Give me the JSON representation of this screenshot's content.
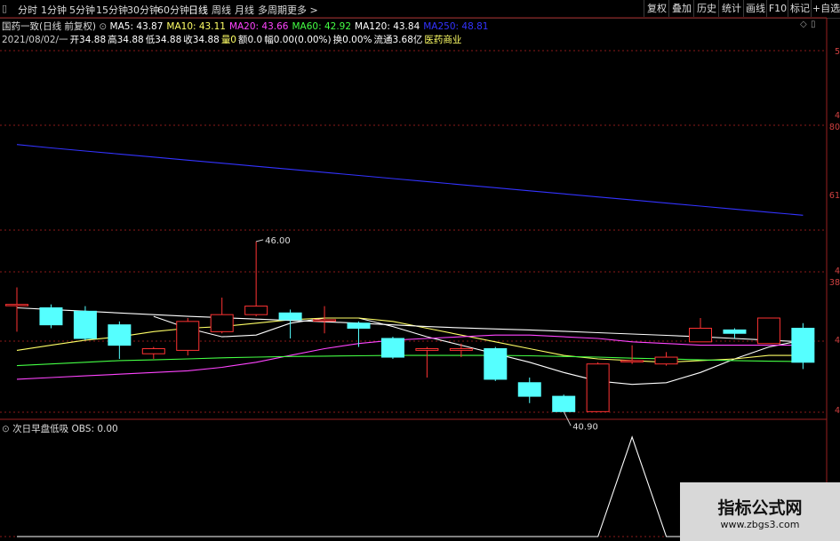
{
  "toolbar": {
    "periods": [
      "分时",
      "1分钟",
      "5分钟",
      "15分钟",
      "30分钟",
      "60分钟",
      "日线",
      "周线",
      "月线",
      "多周期",
      "更多 >"
    ],
    "active_period": "日线",
    "right_buttons": [
      "复权",
      "叠加",
      "历史",
      "统计",
      "画线",
      "F10",
      "标记",
      "+自选"
    ]
  },
  "header": {
    "stock_name": "国药一致(日线 前复权)",
    "ma": [
      {
        "label": "MA5: 43.87",
        "color": "#ffffff"
      },
      {
        "label": "MA10: 43.11",
        "color": "#ffff66"
      },
      {
        "label": "MA20: 43.66",
        "color": "#ff44ff"
      },
      {
        "label": "MA60: 42.92",
        "color": "#44ff44"
      },
      {
        "label": "MA120: 43.84",
        "color": "#ffffff"
      },
      {
        "label": "MA250: 48.81",
        "color": "#3333ff"
      }
    ],
    "bar_info": [
      {
        "label": "2021/08/02/一",
        "color": "#cccccc"
      },
      {
        "label": "开34.88",
        "color": "#ffffff"
      },
      {
        "label": "高34.88",
        "color": "#ffffff"
      },
      {
        "label": "低34.88",
        "color": "#ffffff"
      },
      {
        "label": "收34.88",
        "color": "#ffffff"
      },
      {
        "label": "量0",
        "color": "#ffff66"
      },
      {
        "label": "额0.0",
        "color": "#ffffff"
      },
      {
        "label": "幅0.00(0.00%)",
        "color": "#ffffff"
      },
      {
        "label": "换0.00%",
        "color": "#ffffff"
      },
      {
        "label": "流通3.68亿",
        "color": "#ffffff"
      },
      {
        "label": "医药商业",
        "color": "#ffff66"
      }
    ]
  },
  "annotations": {
    "high": "46.00",
    "low": "40.90"
  },
  "indicator": {
    "title": "次日早盘低吸",
    "obs": "OBS: 0.00"
  },
  "right_axis": [
    "5",
    "4",
    "80",
    "61",
    "4",
    "38",
    "4",
    "4"
  ],
  "watermark": {
    "title": "指标公式网",
    "url": "www.zbgs3.com"
  },
  "colors": {
    "up": "#ff3333",
    "down": "#55ffff",
    "grid": "#8b1a1a"
  },
  "candles": [
    {
      "o": 44.05,
      "c": 44.05,
      "h": 44.55,
      "l": 43.25
    },
    {
      "o": 43.95,
      "c": 43.45,
      "h": 44.05,
      "l": 43.35
    },
    {
      "o": 43.85,
      "c": 43.05,
      "h": 44.0,
      "l": 43.0
    },
    {
      "o": 43.45,
      "c": 42.85,
      "h": 43.55,
      "l": 42.45
    },
    {
      "o": 42.6,
      "c": 42.75,
      "h": 42.8,
      "l": 42.45
    },
    {
      "o": 42.7,
      "c": 43.55,
      "h": 43.65,
      "l": 42.55
    },
    {
      "o": 43.25,
      "c": 43.75,
      "h": 44.25,
      "l": 43.2
    },
    {
      "o": 43.75,
      "c": 44.0,
      "h": 45.9,
      "l": 43.7
    },
    {
      "o": 43.8,
      "c": 43.6,
      "h": 43.9,
      "l": 43.05
    },
    {
      "o": 43.6,
      "c": 43.6,
      "h": 44.0,
      "l": 43.2
    },
    {
      "o": 43.5,
      "c": 43.35,
      "h": 43.55,
      "l": 42.8
    },
    {
      "o": 43.05,
      "c": 42.5,
      "h": 43.1,
      "l": 42.45
    },
    {
      "o": 42.7,
      "c": 42.75,
      "h": 42.8,
      "l": 41.9
    },
    {
      "o": 42.7,
      "c": 42.75,
      "h": 42.9,
      "l": 42.5
    },
    {
      "o": 42.75,
      "c": 41.85,
      "h": 42.8,
      "l": 41.8
    },
    {
      "o": 41.75,
      "c": 41.35,
      "h": 41.9,
      "l": 41.15
    },
    {
      "o": 41.35,
      "c": 40.9,
      "h": 41.4,
      "l": 40.9
    },
    {
      "o": 40.9,
      "c": 42.3,
      "h": 42.35,
      "l": 40.9
    },
    {
      "o": 42.4,
      "c": 42.4,
      "h": 42.85,
      "l": 42.3
    },
    {
      "o": 42.3,
      "c": 42.5,
      "h": 42.65,
      "l": 42.25
    },
    {
      "o": 42.95,
      "c": 43.35,
      "h": 43.65,
      "l": 42.95
    },
    {
      "o": 43.3,
      "c": 43.2,
      "h": 43.35,
      "l": 43.05
    },
    {
      "o": 42.9,
      "c": 43.65,
      "h": 43.65,
      "l": 42.9
    },
    {
      "o": 43.35,
      "c": 42.35,
      "h": 43.5,
      "l": 42.15
    }
  ],
  "ma_lines": [
    {
      "name": "MA5",
      "color": "#ffffff",
      "values": [
        null,
        null,
        null,
        null,
        43.7,
        43.35,
        43.1,
        43.15,
        43.5,
        43.65,
        43.65,
        43.4,
        43.1,
        42.85,
        42.6,
        42.35,
        42.05,
        41.8,
        41.7,
        41.75,
        42.05,
        42.45,
        42.8,
        43.0
      ]
    },
    {
      "name": "MA10",
      "color": "#ffff66",
      "values": [
        42.7,
        42.85,
        43.0,
        43.1,
        43.25,
        43.35,
        43.4,
        43.5,
        43.6,
        43.65,
        43.65,
        43.55,
        43.35,
        43.15,
        42.95,
        42.75,
        42.55,
        42.45,
        42.4,
        42.35,
        42.4,
        42.45,
        42.55,
        42.55
      ]
    },
    {
      "name": "MA20",
      "color": "#ff44ff",
      "values": [
        41.85,
        41.9,
        41.95,
        42.0,
        42.05,
        42.1,
        42.2,
        42.35,
        42.55,
        42.75,
        42.9,
        43.0,
        43.05,
        43.1,
        43.15,
        43.15,
        43.1,
        43.05,
        42.95,
        42.9,
        42.85,
        42.85,
        42.85,
        42.85
      ]
    },
    {
      "name": "MA60",
      "color": "#44ff44",
      "values": [
        42.25,
        42.3,
        42.35,
        42.4,
        42.42,
        42.45,
        42.48,
        42.5,
        42.52,
        42.53,
        42.54,
        42.55,
        42.55,
        42.55,
        42.55,
        42.54,
        42.52,
        42.5,
        42.47,
        42.45,
        42.42,
        42.4,
        42.38,
        42.37
      ]
    },
    {
      "name": "MA120",
      "color": "#ffffff",
      "values": [
        43.95,
        43.9,
        43.85,
        43.8,
        43.75,
        43.7,
        43.66,
        43.62,
        43.58,
        43.54,
        43.5,
        43.45,
        43.4,
        43.36,
        43.33,
        43.3,
        43.26,
        43.22,
        43.18,
        43.14,
        43.1,
        43.05,
        43.0,
        42.95
      ]
    },
    {
      "name": "MA250",
      "color": "#3333ff",
      "values": [
        48.75,
        48.65,
        48.56,
        48.47,
        48.38,
        48.29,
        48.2,
        48.11,
        48.02,
        47.93,
        47.84,
        47.75,
        47.66,
        47.57,
        47.48,
        47.39,
        47.3,
        47.21,
        47.12,
        47.03,
        46.94,
        46.85,
        46.76,
        46.67
      ]
    }
  ],
  "obs_values": [
    0,
    0,
    0,
    0,
    0,
    0,
    0,
    0,
    0,
    0,
    0,
    0,
    0,
    0,
    0,
    0,
    0,
    0,
    1,
    0,
    0,
    0,
    0,
    0
  ]
}
